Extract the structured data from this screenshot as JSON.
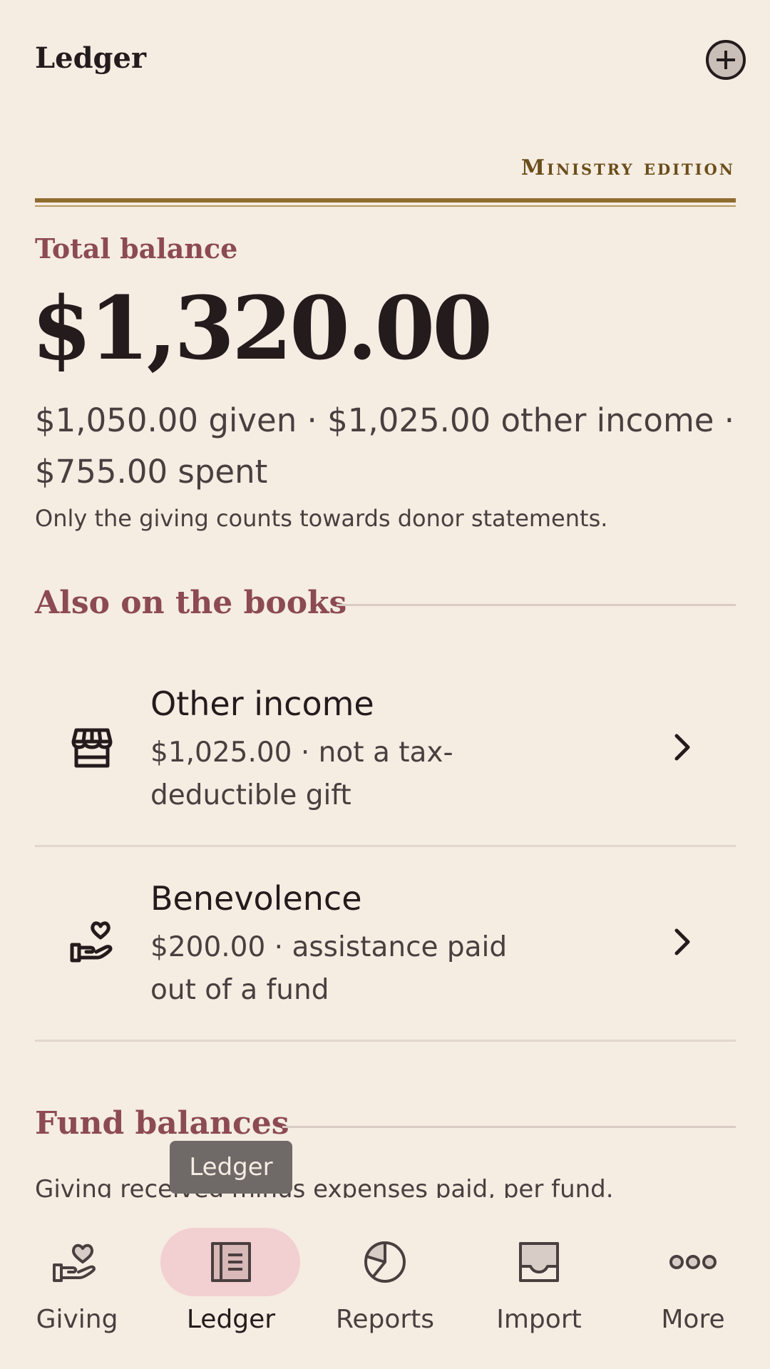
{
  "appbar": {
    "title": "Ledger"
  },
  "edition": "Ministry edition",
  "balance": {
    "label": "Total balance",
    "amount": "$1,320.00",
    "summary": "$1,050.00 given · $1,025.00 other income · $755.00 spent",
    "note": "Only the giving counts towards donor statements."
  },
  "books": {
    "title": "Also on the books",
    "items": [
      {
        "title": "Other income",
        "subtitle": "$1,025.00 · not a tax-deductible gift",
        "icon": "storefront-icon"
      },
      {
        "title": "Benevolence",
        "subtitle": "$200.00 · assistance paid out of a fund",
        "icon": "hand-heart-icon"
      }
    ]
  },
  "funds": {
    "title": "Fund balances",
    "subtitle": "Giving received minus expenses paid, per fund."
  },
  "tooltip": "Ledger",
  "nav": {
    "active": "Ledger",
    "items": [
      {
        "label": "Giving",
        "icon": "hand-heart-icon"
      },
      {
        "label": "Ledger",
        "icon": "ledger-icon"
      },
      {
        "label": "Reports",
        "icon": "pie-chart-icon"
      },
      {
        "label": "Import",
        "icon": "inbox-icon"
      },
      {
        "label": "More",
        "icon": "more-icon"
      }
    ]
  },
  "colors": {
    "background": "#f5ece2",
    "accent_gold": "#8f6d2f",
    "accent_rose": "#8c4a52",
    "active_pill": "#f2cfd1"
  }
}
